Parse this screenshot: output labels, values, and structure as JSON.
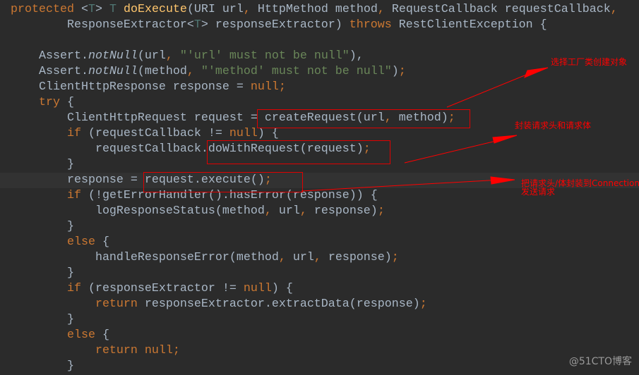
{
  "editor": {
    "lines": [
      [
        [
          "kw",
          "protected "
        ],
        [
          "",
          "<"
        ],
        [
          "tp",
          "T"
        ],
        [
          "",
          "> "
        ],
        [
          "tp",
          "T "
        ],
        [
          "fn",
          "doExecute"
        ],
        [
          "",
          "(URI url"
        ],
        [
          "kw",
          ", "
        ],
        [
          "",
          "HttpMethod method"
        ],
        [
          "kw",
          ", "
        ],
        [
          "",
          "RequestCallback requestCallback"
        ],
        [
          "kw",
          ","
        ]
      ],
      [
        [
          "",
          "        ResponseExtractor<"
        ],
        [
          "tp",
          "T"
        ],
        [
          "",
          "> responseExtractor) "
        ],
        [
          "kw",
          "throws "
        ],
        [
          "",
          "RestClientException {"
        ]
      ],
      [],
      [
        [
          "",
          "    Assert."
        ],
        [
          "it",
          "notNull"
        ],
        [
          "",
          "(url"
        ],
        [
          "kw",
          ", "
        ],
        [
          "str",
          "\"'url' must not be null\""
        ],
        [
          "",
          "),"
        ],
        [
          "kw",
          ""
        ]
      ],
      [
        [
          "",
          "    Assert."
        ],
        [
          "it",
          "notNull"
        ],
        [
          "",
          "(method"
        ],
        [
          "kw",
          ", "
        ],
        [
          "str",
          "\"'method' must not be null\""
        ],
        [
          "",
          ")"
        ],
        [
          "kw",
          ";"
        ]
      ],
      [
        [
          "",
          "    ClientHttpResponse response = "
        ],
        [
          "kw",
          "null;"
        ]
      ],
      [
        [
          "kw",
          "    try "
        ],
        [
          "",
          "{"
        ]
      ],
      [
        [
          "",
          "        ClientHttpRequest request = createRequest(url"
        ],
        [
          "kw",
          ", "
        ],
        [
          "",
          "method)"
        ],
        [
          "kw",
          ";"
        ]
      ],
      [
        [
          "kw",
          "        if "
        ],
        [
          "",
          "(requestCallback != "
        ],
        [
          "kw",
          "null"
        ],
        [
          "",
          ") {"
        ]
      ],
      [
        [
          "",
          "            requestCallback.doWithRequest(request)"
        ],
        [
          "kw",
          ";"
        ]
      ],
      [
        [
          "",
          "        }"
        ]
      ],
      [
        [
          "",
          "        response = request.execute()"
        ],
        [
          "kw",
          ";"
        ]
      ],
      [
        [
          "kw",
          "        if "
        ],
        [
          "",
          "(!getErrorHandler().hasError(response)) {"
        ]
      ],
      [
        [
          "",
          "            logResponseStatus(method"
        ],
        [
          "kw",
          ", "
        ],
        [
          "",
          "url"
        ],
        [
          "kw",
          ", "
        ],
        [
          "",
          "response)"
        ],
        [
          "kw",
          ";"
        ]
      ],
      [
        [
          "",
          "        }"
        ]
      ],
      [
        [
          "kw",
          "        else "
        ],
        [
          "",
          "{"
        ]
      ],
      [
        [
          "",
          "            handleResponseError(method"
        ],
        [
          "kw",
          ", "
        ],
        [
          "",
          "url"
        ],
        [
          "kw",
          ", "
        ],
        [
          "",
          "response)"
        ],
        [
          "kw",
          ";"
        ]
      ],
      [
        [
          "",
          "        }"
        ]
      ],
      [
        [
          "kw",
          "        if "
        ],
        [
          "",
          "(responseExtractor != "
        ],
        [
          "kw",
          "null"
        ],
        [
          "",
          ") {"
        ]
      ],
      [
        [
          "kw",
          "            return "
        ],
        [
          "",
          "responseExtractor.extractData(response)"
        ],
        [
          "kw",
          ";"
        ]
      ],
      [
        [
          "",
          "        }"
        ]
      ],
      [
        [
          "kw",
          "        else "
        ],
        [
          "",
          "{"
        ]
      ],
      [
        [
          "kw",
          "            return null;"
        ]
      ],
      [
        [
          "",
          "        }"
        ]
      ]
    ]
  },
  "annotations": {
    "note1": "选择工厂类创建对象",
    "note2": "封装请求头和请求体",
    "note3_line1": "把请求头/体封装到Connection",
    "note3_line2": "发送请求",
    "color": "#ff0000"
  },
  "watermark": "@51CTO博客"
}
